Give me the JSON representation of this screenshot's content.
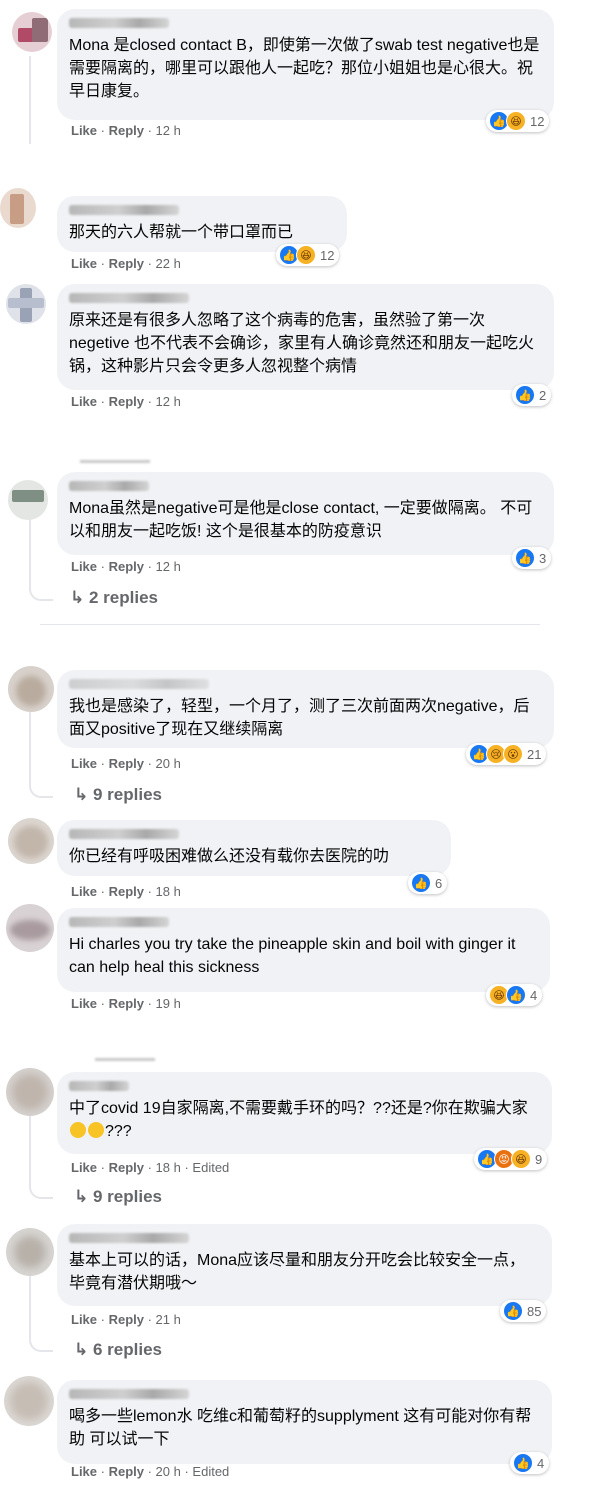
{
  "colors": {
    "accent": "#1877f2",
    "bubble": "#f0f2f5",
    "meta": "#65676b"
  },
  "comments": [
    {
      "text": "Mona 是closed contact B，即使第一次做了swab test negative也是需要隔离的，哪里可以跟他人一起吃？那位小姐姐也是心很大。祝早日康复。",
      "like": "Like",
      "reply": "Reply",
      "time": "12 h",
      "reaction_count": "12"
    },
    {
      "text": "那天的六人帮就一个带口罩而已",
      "like": "Like",
      "reply": "Reply",
      "time": "22 h",
      "reaction_count": "12"
    },
    {
      "text": "原来还是有很多人忽略了这个病毒的危害，虽然验了第一次negetive 也不代表不会确诊，家里有人确诊竟然还和朋友一起吃火锅，这种影片只会令更多人忽视整个病情",
      "like": "Like",
      "reply": "Reply",
      "time": "12 h",
      "reaction_count": "2"
    },
    {
      "text": "Mona虽然是negative可是他是close contact, 一定要做隔离。 不可以和朋友一起吃饭! 这个是很基本的防疫意识",
      "like": "Like",
      "reply": "Reply",
      "time": "12 h",
      "reaction_count": "3",
      "replies": "2 replies"
    },
    {
      "text": "我也是感染了，轻型，一个月了，测了三次前面两次negative，后面又positive了现在又继续隔离",
      "like": "Like",
      "reply": "Reply",
      "time": "20 h",
      "reaction_count": "21",
      "replies": "9 replies"
    },
    {
      "text": "你已经有呼吸困难做么还没有载你去医院的叻",
      "like": "Like",
      "reply": "Reply",
      "time": "18 h",
      "reaction_count": "6"
    },
    {
      "text": "Hi charles you try take the pineapple skin and boil with ginger it can help heal this sickness",
      "like": "Like",
      "reply": "Reply",
      "time": "19 h",
      "reaction_count": "4"
    },
    {
      "text_a": "中了covid 19自家隔离,不需要戴手环的吗？??还是?你在欺骗大家",
      "text_b": "???",
      "like": "Like",
      "reply": "Reply",
      "time": "18 h",
      "edited": "Edited",
      "reaction_count": "9",
      "replies": "9 replies"
    },
    {
      "text": "基本上可以的话，Mona应该尽量和朋友分开吃会比较安全一点，毕竟有潜伏期哦～",
      "like": "Like",
      "reply": "Reply",
      "time": "21 h",
      "reaction_count": "85",
      "replies": "6 replies"
    },
    {
      "text": "喝多一些lemon水 吃维c和葡萄籽的supplyment 这有可能对你有帮助 可以试一下",
      "like": "Like",
      "reply": "Reply",
      "time": "20 h",
      "edited": "Edited",
      "reaction_count": "4"
    }
  ]
}
